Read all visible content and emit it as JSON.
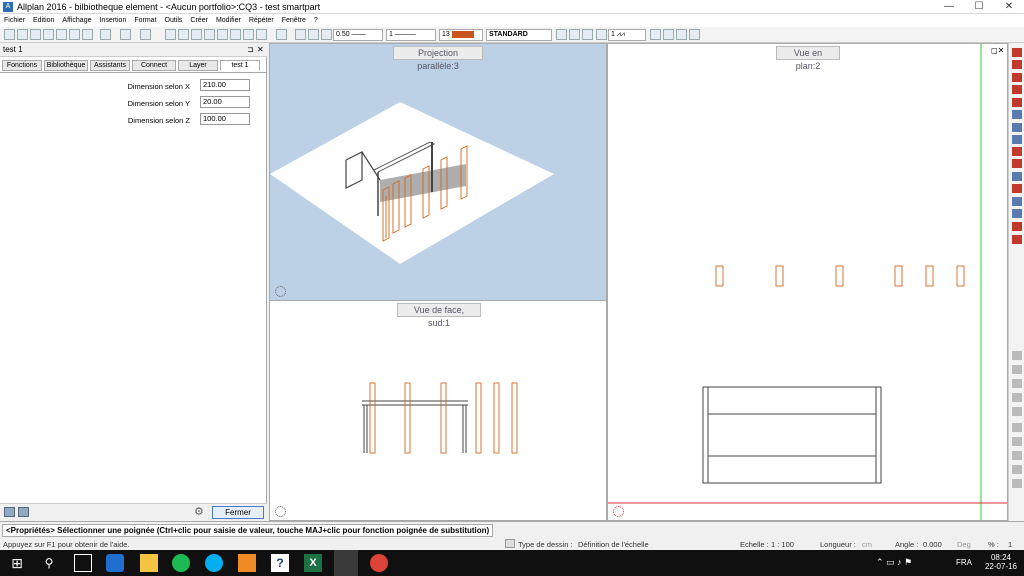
{
  "titlebar": {
    "title": "Allplan 2016 - bilbiotheque element - <Aucun portfolio>:CQ3 - test smartpart",
    "app_icon": "allplan-logo-icon",
    "minimize": "—",
    "maximize": "☐",
    "close": "✕"
  },
  "menu": [
    "Fichier",
    "Edition",
    "Affichage",
    "Insertion",
    "Format",
    "Outils",
    "Créer",
    "Modifier",
    "Répéter",
    "Fenêtre",
    "?"
  ],
  "toolbar": {
    "pen_value": "0.50",
    "line_value": "1",
    "color_value": "13",
    "layer_value": "STANDARD",
    "scale_value": "1",
    "color_swatch": "#c8561e"
  },
  "left_panel": {
    "title": "test 1",
    "pin": "⊐",
    "close": "✕",
    "tabs": [
      "Fonctions",
      "Bibliothèque",
      "Assistants",
      "Connect",
      "Layer",
      "test 1"
    ],
    "properties": [
      {
        "label": "Dimension selon X",
        "value": "210.00"
      },
      {
        "label": "Dimension selon Y",
        "value": "20.00"
      },
      {
        "label": "Dimension selon Z",
        "value": "100.00"
      }
    ],
    "close_button": "Fermer"
  },
  "views": {
    "iso": "Projection parallèle:3",
    "plan": "Vue en plan:2",
    "front": "Vue de face, sud:1"
  },
  "hint": "<Propriétés> Sélectionner une poignée (Ctrl+clic pour saisie de valeur, touche MAJ+clic pour fonction poignée de substitution)",
  "status": {
    "help": "Appuyez sur F1 pour obtenir de l'aide.",
    "drawing_type_label": "Type de dessin :",
    "drawing_type_value": "Définition de l'échelle",
    "scale_label": "Echelle :",
    "scale_value": "1 : 100",
    "length_label": "Longueur :",
    "length_unit": "cm",
    "angle_label": "Angle :",
    "angle_value": "0.000",
    "angle_unit": "Deg",
    "percent_label": "% :",
    "percent_value": "1"
  },
  "taskbar": {
    "time": "08:24",
    "date": "22-07-16",
    "lang": "FRA"
  },
  "colors": {
    "object_orange": "#d2691e",
    "iso_bg": "#bcd0e6",
    "accent_red": "#c0392b"
  }
}
